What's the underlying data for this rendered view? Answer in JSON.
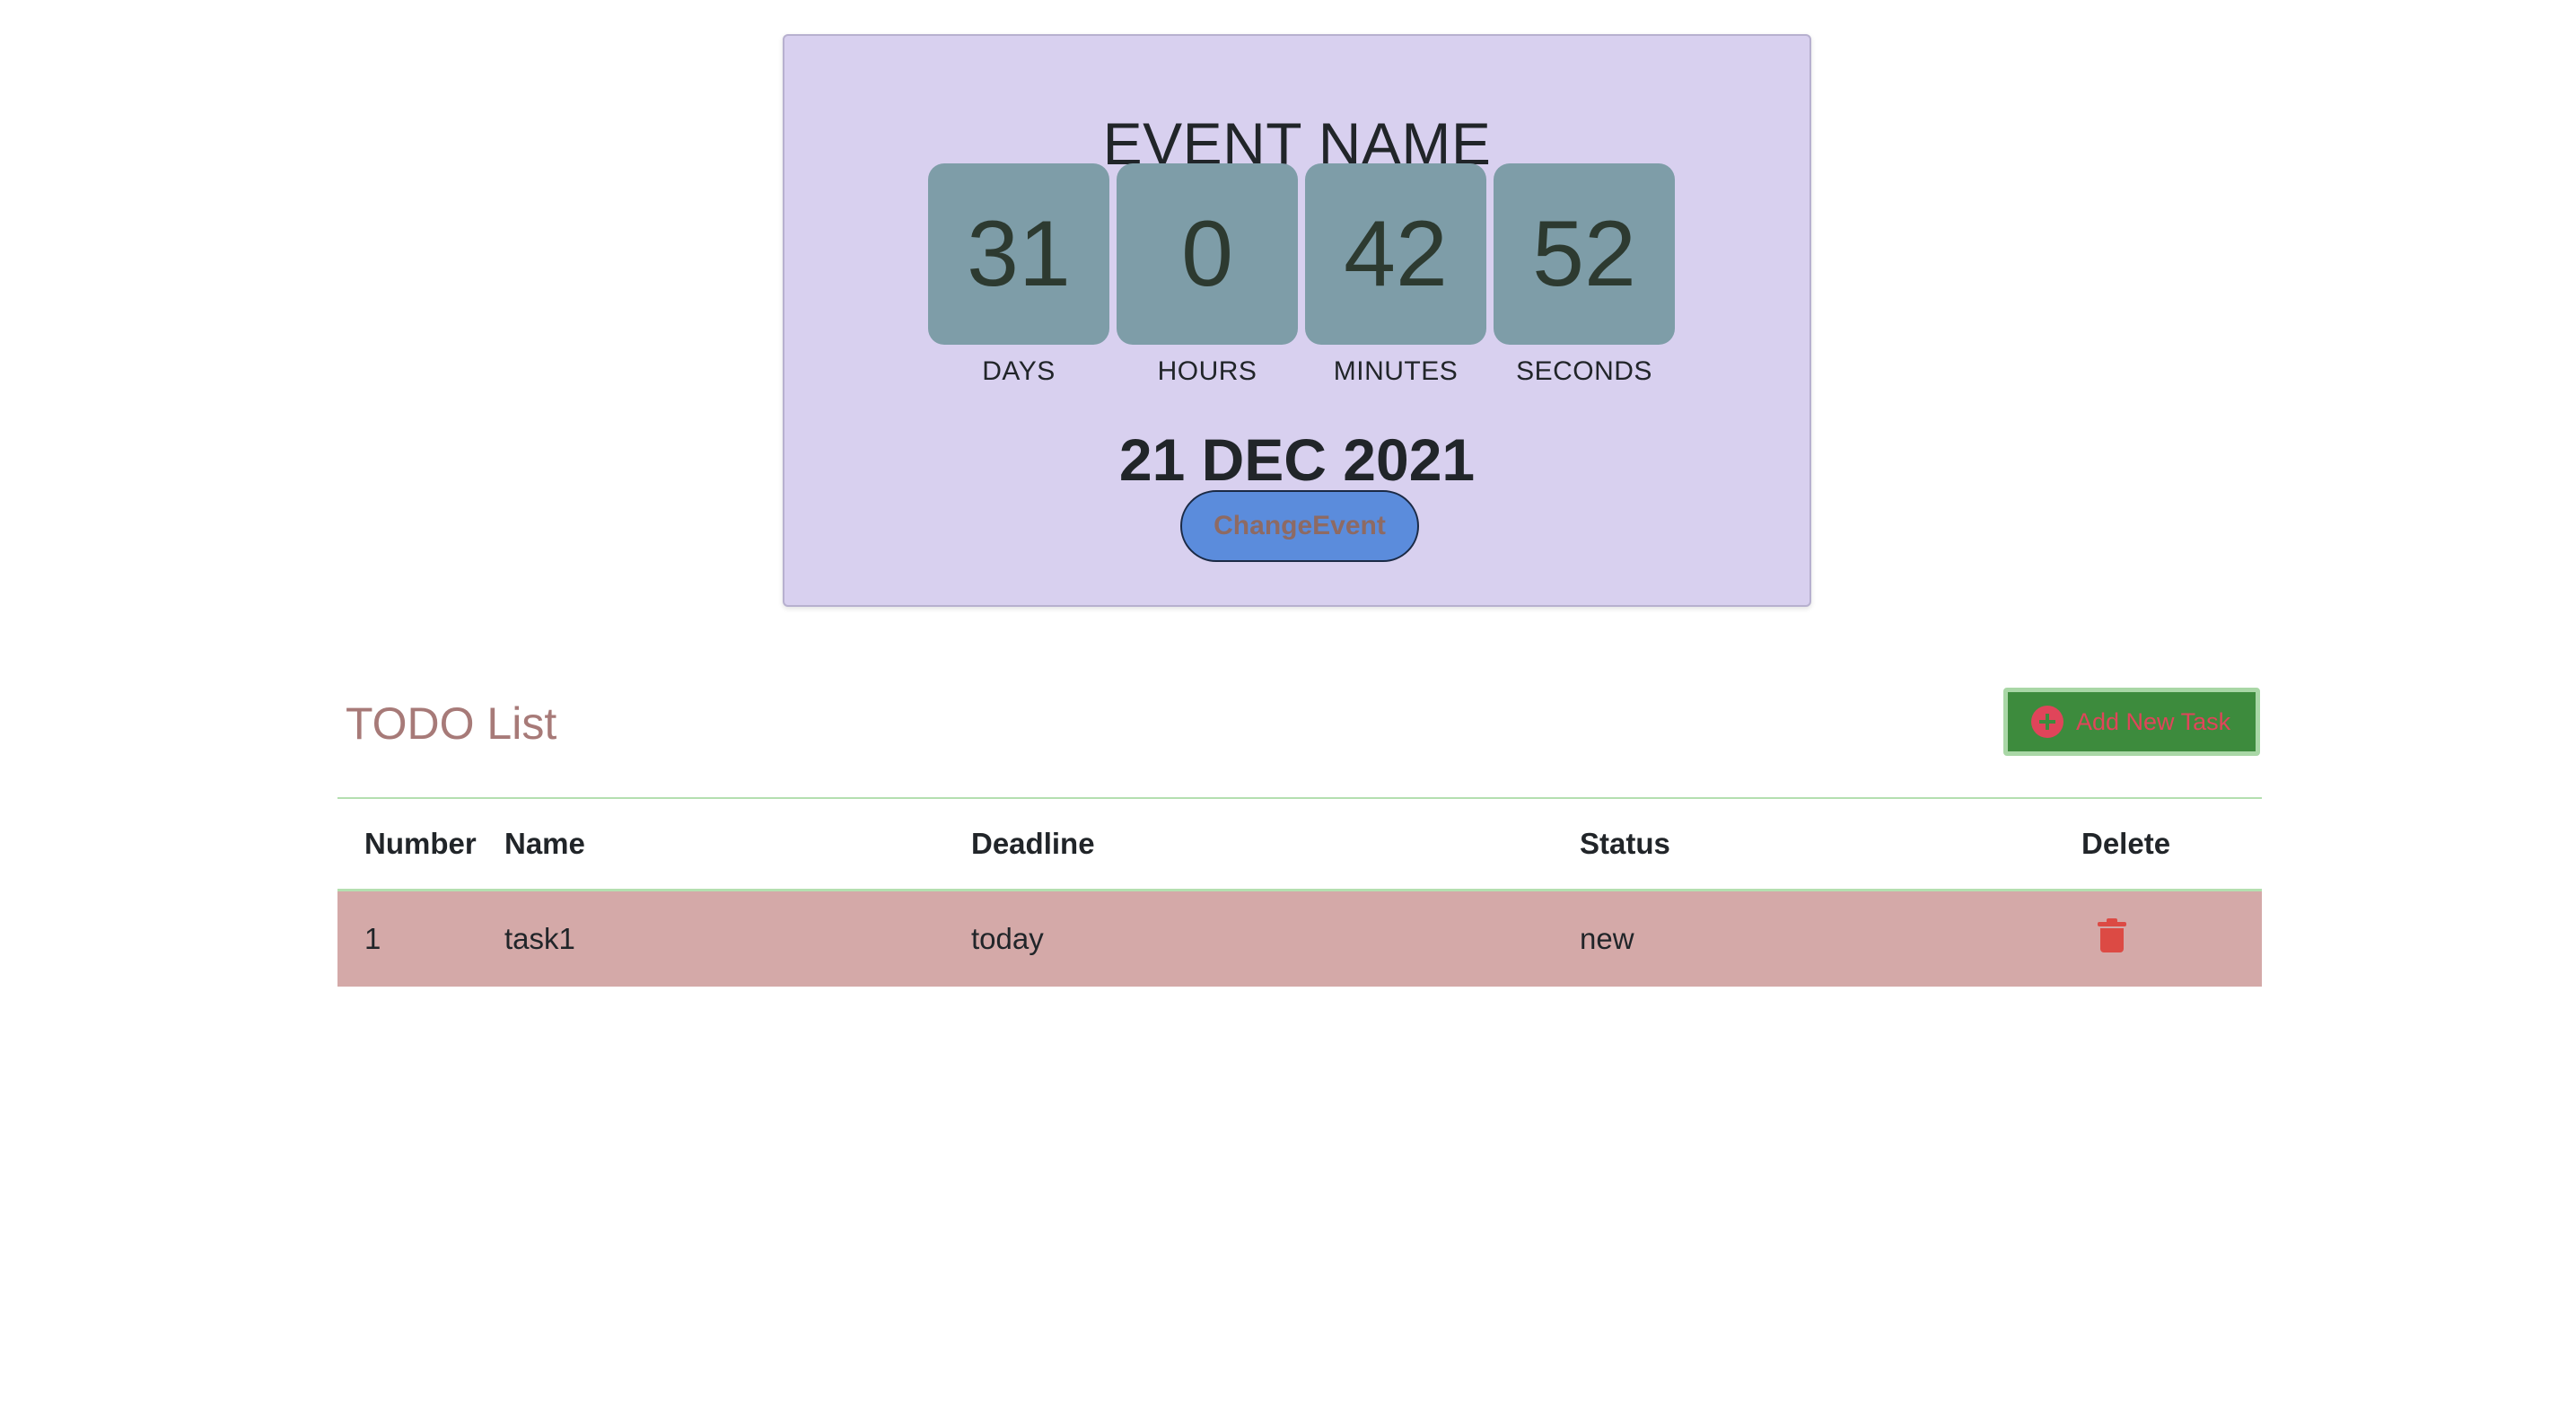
{
  "event": {
    "title": "EVENT NAME",
    "countdown": [
      {
        "value": "31",
        "label": "DAYS"
      },
      {
        "value": "0",
        "label": "HOURS"
      },
      {
        "value": "42",
        "label": "MINUTES"
      },
      {
        "value": "52",
        "label": "SECONDS"
      }
    ],
    "date": "21 DEC 2021",
    "change_button": "ChangeEvent"
  },
  "todo": {
    "title": "TODO List",
    "add_button": "Add New Task",
    "add_icon": "plus-circle-icon",
    "columns": [
      "Number",
      "Name",
      "Deadline",
      "Status",
      "Delete"
    ],
    "rows": [
      {
        "number": "1",
        "name": "task1",
        "deadline": "today",
        "status": "new",
        "delete_icon": "trash-icon"
      }
    ]
  },
  "colors": {
    "card_background": "#d8d0ef",
    "countdown_box": "#7e9da8",
    "change_button": "#5b8cdc",
    "add_button": "#3d8b3d",
    "row_background": "#d4a9a8",
    "delete_icon": "#dc4a44"
  }
}
